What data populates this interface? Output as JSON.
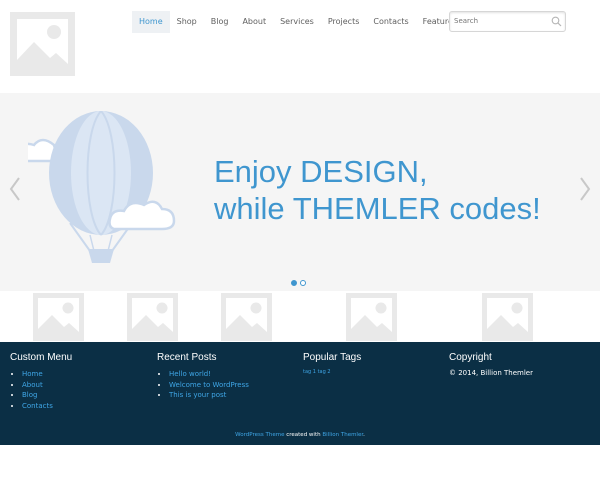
{
  "nav": {
    "items": [
      {
        "label": "Home",
        "active": true
      },
      {
        "label": "Shop"
      },
      {
        "label": "Blog"
      },
      {
        "label": "About"
      },
      {
        "label": "Services"
      },
      {
        "label": "Projects"
      },
      {
        "label": "Contacts"
      },
      {
        "label": "Features"
      }
    ]
  },
  "search": {
    "placeholder": "Search",
    "icon": "search-icon"
  },
  "slider": {
    "line1": "Enjoy DESIGN,",
    "line2": "while THEMLER codes!",
    "prev_icon": "chevron-left-icon",
    "next_icon": "chevron-right-icon",
    "dots_total": 2,
    "active_dot": 1
  },
  "footer": {
    "menu": {
      "title": "Custom Menu",
      "items": [
        "Home",
        "About",
        "Blog",
        "Contacts"
      ]
    },
    "posts": {
      "title": "Recent Posts",
      "items": [
        "Hello world!",
        "Welcome to WordPress",
        "This is your post"
      ]
    },
    "tags": {
      "title": "Popular Tags",
      "items": [
        "tag 1",
        "tag 2"
      ]
    },
    "copyright": {
      "title": "Copyright",
      "text": "© 2014, Billion Themler"
    },
    "credit": {
      "link1": "WordPress Theme",
      "middle": " created with ",
      "link2": "Billion Themler",
      "end": "."
    }
  },
  "colors": {
    "accent": "#3f96cf",
    "footer_bg": "#0b2f45",
    "slider_bg": "#f5f5f5",
    "placeholder": "#e9e9e9"
  }
}
